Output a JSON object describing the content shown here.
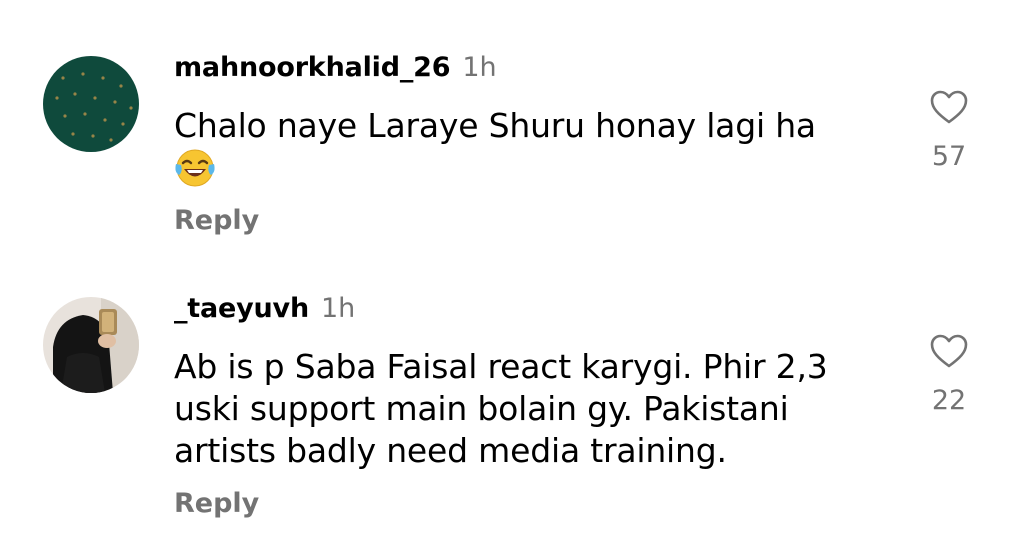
{
  "comments": [
    {
      "username": "mahnoorkhalid_26",
      "time": "1h",
      "text_lines": [
        "Chalo naye Laraye Shuru honay lagi ha"
      ],
      "emoji": "face-with-tears-of-joy",
      "reply_label": "Reply",
      "like_count": "57",
      "avatar": "dark-green-patterned"
    },
    {
      "username": "_taeyuvh",
      "time": "1h",
      "text_lines": [
        "Ab is p Saba Faisal react karygi. Phir 2,3",
        "uski support main bolain gy. Pakistani",
        "artists badly need media training."
      ],
      "reply_label": "Reply",
      "like_count": "22",
      "avatar": "person-photo"
    }
  ],
  "colors": {
    "secondary_text": "#737373",
    "primary_text": "#000000",
    "avatar_green": "#0f4a3c"
  },
  "icons": [
    "heart-outline-icon",
    "laughing-emoji-icon"
  ]
}
